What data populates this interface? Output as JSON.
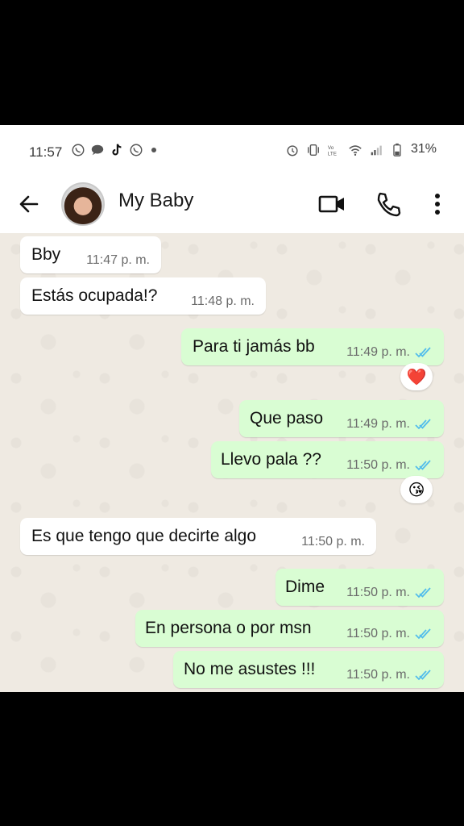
{
  "status_bar": {
    "time": "11:57",
    "battery": "31%",
    "network_label": "Vo LTE"
  },
  "header": {
    "contact_name": "My Baby"
  },
  "messages": [
    {
      "dir": "in",
      "text": "Bby",
      "time": "11:47 p. m."
    },
    {
      "dir": "in",
      "text": "Estás ocupada!?",
      "time": "11:48 p. m."
    },
    {
      "dir": "out",
      "text": "Para ti jamás bb",
      "time": "11:49 p. m.",
      "reaction": "❤️"
    },
    {
      "dir": "out",
      "text": "Que paso",
      "time": "11:49 p. m."
    },
    {
      "dir": "out",
      "text": "Llevo pala ??",
      "time": "11:50 p. m.",
      "reaction": "😘"
    },
    {
      "dir": "in",
      "text": "Es que tengo que decirte algo",
      "time": "11:50 p. m."
    },
    {
      "dir": "out",
      "text": "Dime",
      "time": "11:50 p. m."
    },
    {
      "dir": "out",
      "text": "En persona o por msn",
      "time": "11:50 p. m."
    },
    {
      "dir": "out",
      "text": "No me asustes !!!",
      "time": "11:50 p. m."
    }
  ],
  "colors": {
    "incoming_bubble": "#ffffff",
    "outgoing_bubble": "#d9fdd3",
    "chat_background": "#efeae2",
    "read_ticks": "#53bdeb"
  }
}
